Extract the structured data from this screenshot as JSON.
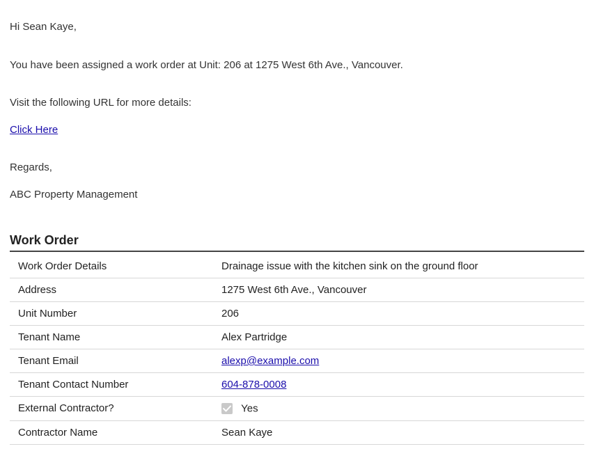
{
  "message": {
    "greeting": "Hi Sean Kaye,",
    "body": "You have been assigned a work order at Unit: 206 at 1275 West 6th Ave., Vancouver.",
    "visit_prompt": "Visit the following URL for more details:",
    "link_text": "Click Here",
    "regards": "Regards,",
    "sender": "ABC Property Management"
  },
  "work_order": {
    "heading": "Work Order",
    "rows": {
      "details_label": "Work Order Details",
      "details_value": "Drainage issue with the kitchen sink on the ground floor",
      "address_label": "Address",
      "address_value": "1275 West 6th Ave., Vancouver",
      "unit_label": "Unit Number",
      "unit_value": "206",
      "tenant_name_label": "Tenant Name",
      "tenant_name_value": "Alex Partridge",
      "tenant_email_label": "Tenant Email",
      "tenant_email_value": "alexp@example.com",
      "tenant_contact_label": "Tenant Contact Number",
      "tenant_contact_value": "604-878-0008",
      "external_label": "External Contractor?",
      "external_value": "Yes",
      "contractor_label": "Contractor Name",
      "contractor_value": "Sean Kaye"
    }
  }
}
